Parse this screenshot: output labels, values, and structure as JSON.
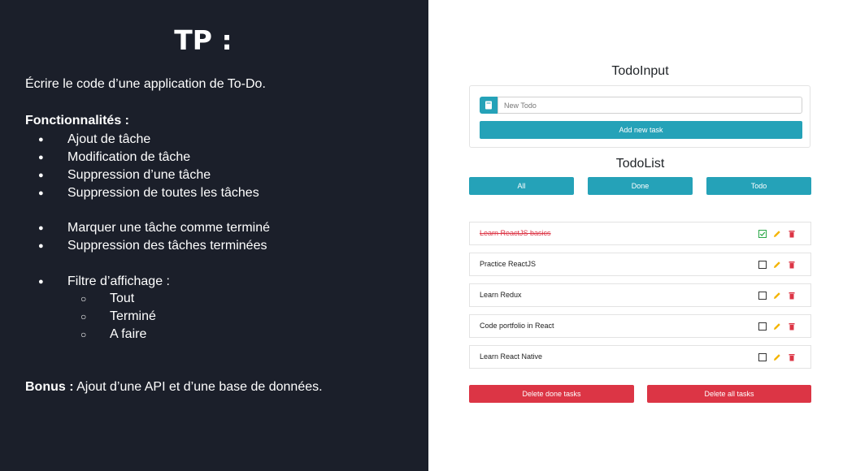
{
  "slide": {
    "title": "TP :",
    "intro": "Écrire le code d’une application de To-Do.",
    "features_title": "Fonctionnalités :",
    "features": [
      "Ajout de tâche",
      "Modification de tâche",
      "Suppression d’une tâche",
      "Suppression de toutes les tâches",
      "Marquer une tâche comme terminé",
      "Suppression des tâches terminées",
      "Filtre d’affichage :"
    ],
    "filters": [
      "Tout",
      "Terminé",
      "A faire"
    ],
    "bonus_label": "Bonus :",
    "bonus_text": " Ajout d’une API et d’une base de données."
  },
  "app": {
    "input_heading": "TodoInput",
    "input_placeholder": "New Todo",
    "add_button": "Add new task",
    "list_heading": "TodoList",
    "filter_buttons": [
      "All",
      "Done",
      "Todo"
    ],
    "tasks": [
      {
        "text": "Learn ReactJS basics",
        "done": true
      },
      {
        "text": "Practice ReactJS",
        "done": false
      },
      {
        "text": "Learn Redux",
        "done": false
      },
      {
        "text": "Code portfolio in React",
        "done": false
      },
      {
        "text": "Learn React Native",
        "done": false
      }
    ],
    "delete_done_button": "Delete done tasks",
    "delete_all_button": "Delete all tasks",
    "icons": {
      "input": "book-icon",
      "check": "checkbox-icon",
      "edit": "pencil-icon",
      "delete": "trash-icon"
    },
    "colors": {
      "accent": "#25a2b8",
      "danger": "#dc3545",
      "edit": "#f4b400",
      "checked": "#28a745",
      "panel": "#1b1f2a"
    }
  }
}
